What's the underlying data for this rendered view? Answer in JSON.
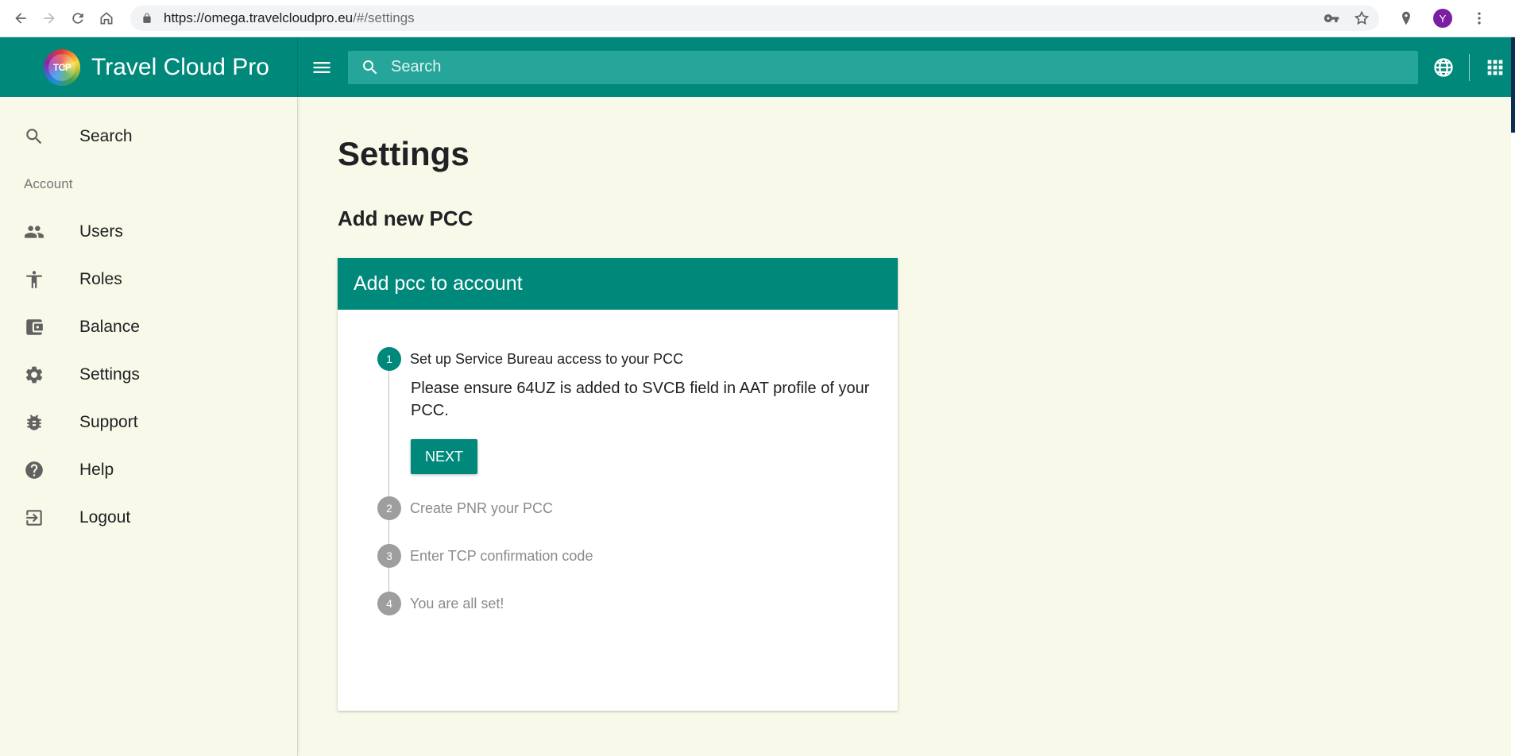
{
  "browser": {
    "url_host": "https://omega.travelcloudpro.eu",
    "url_path": "/#/settings",
    "profile_initial": "Y"
  },
  "appbar": {
    "logo_text": "TCP",
    "brand_name": "Travel Cloud Pro",
    "search_placeholder": "Search"
  },
  "sidebar": {
    "search_label": "Search",
    "section_label": "Account",
    "items": [
      {
        "label": "Users",
        "icon": "users-icon"
      },
      {
        "label": "Roles",
        "icon": "person-icon"
      },
      {
        "label": "Balance",
        "icon": "wallet-icon"
      },
      {
        "label": "Settings",
        "icon": "gear-icon"
      },
      {
        "label": "Support",
        "icon": "bug-icon"
      },
      {
        "label": "Help",
        "icon": "help-icon"
      },
      {
        "label": "Logout",
        "icon": "logout-icon"
      }
    ]
  },
  "main": {
    "title": "Settings",
    "subtitle": "Add new PCC",
    "card": {
      "header": "Add pcc to account",
      "steps": [
        {
          "num": "1",
          "label": "Set up Service Bureau access to your PCC"
        },
        {
          "num": "2",
          "label": "Create PNR your PCC"
        },
        {
          "num": "3",
          "label": "Enter TCP confirmation code"
        },
        {
          "num": "4",
          "label": "You are all set!"
        }
      ],
      "step1_text": "Please ensure 64UZ is added to SVCB field in AAT profile of your PCC.",
      "next_label": "NEXT"
    }
  },
  "colors": {
    "primary": "#00897b",
    "background": "#f8f9e8",
    "inactive_step": "#9e9e9e"
  }
}
